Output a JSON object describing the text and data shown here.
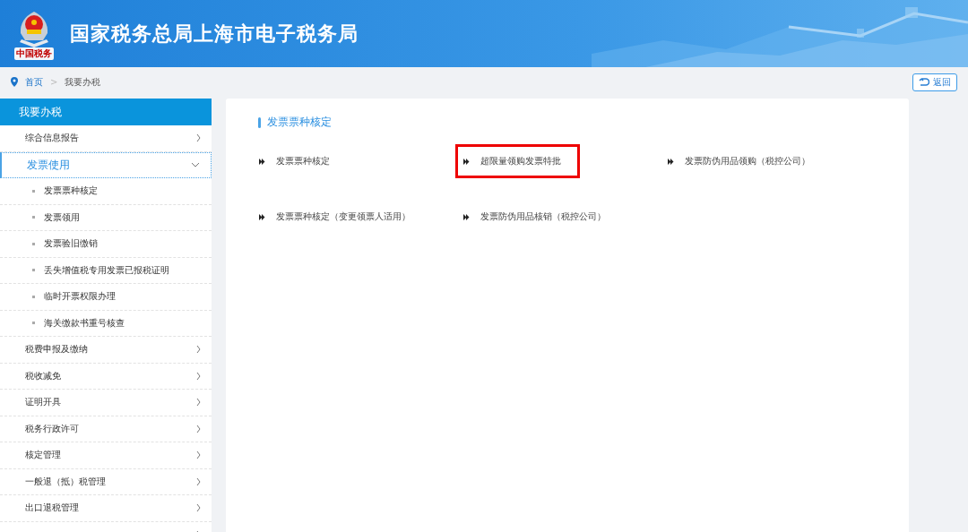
{
  "header": {
    "title": "国家税务总局上海市电子税务局",
    "logo_text": "中国税务"
  },
  "breadcrumb_separator": ">",
  "breadcrumb": [
    {
      "label": "首页",
      "link": true
    },
    {
      "label": "我要办税",
      "link": false
    }
  ],
  "back_button": {
    "label": "返回"
  },
  "sidebar": {
    "title": "我要办税",
    "items": [
      {
        "label": "综合信息报告",
        "expanded": false
      },
      {
        "label": "发票使用",
        "expanded": true,
        "children": [
          {
            "label": "发票票种核定"
          },
          {
            "label": "发票领用"
          },
          {
            "label": "发票验旧缴销"
          },
          {
            "label": "丢失增值税专用发票已报税证明"
          },
          {
            "label": "临时开票权限办理"
          },
          {
            "label": "海关缴款书重号核查"
          }
        ]
      },
      {
        "label": "税费申报及缴纳",
        "expanded": false
      },
      {
        "label": "税收减免",
        "expanded": false
      },
      {
        "label": "证明开具",
        "expanded": false
      },
      {
        "label": "税务行政许可",
        "expanded": false
      },
      {
        "label": "核定管理",
        "expanded": false
      },
      {
        "label": "一般退（抵）税管理",
        "expanded": false
      },
      {
        "label": "出口退税管理",
        "expanded": false
      },
      {
        "expanded": false
      }
    ]
  },
  "panel": {
    "title": "发票票种核定",
    "links": [
      {
        "label": "发票票种核定",
        "highlighted": false
      },
      {
        "label": "超限量领购发票特批",
        "highlighted": true
      },
      {
        "label": "发票防伪用品领购（税控公司）",
        "highlighted": false
      },
      {
        "label": "发票票种核定（变更领票人适用）",
        "highlighted": false
      },
      {
        "label": "发票防伪用品核销（税控公司）",
        "highlighted": false
      }
    ]
  }
}
